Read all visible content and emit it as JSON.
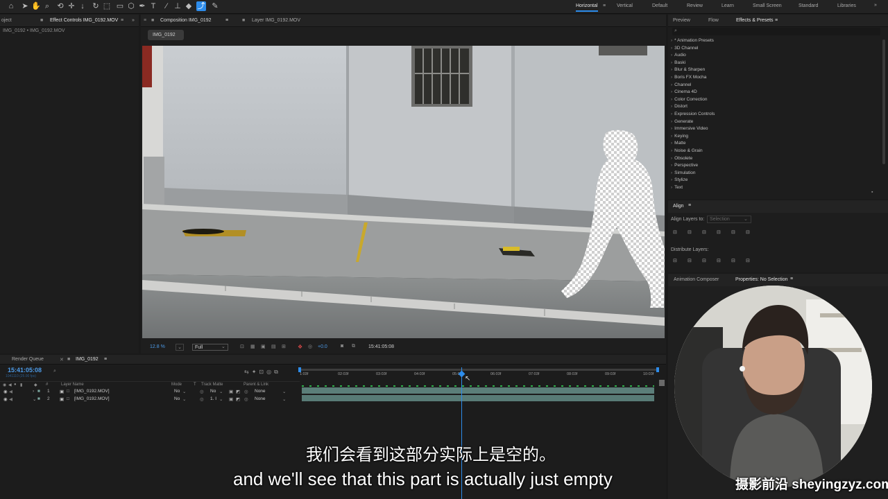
{
  "toolbar": {
    "workspaces": [
      "Horizontal",
      "Vertical",
      "Default",
      "Review",
      "Learn",
      "Small Screen",
      "Standard",
      "Libraries"
    ],
    "active_workspace": "Horizontal"
  },
  "left_panel": {
    "tab_project": "oject",
    "tab_effect_controls": "Effect Controls IMG_0192.MOV",
    "breadcrumb": "IMG_0192 • IMG_0192.MOV"
  },
  "composition": {
    "tab_composition": "Composition IMG_0192",
    "tab_layer": "Layer IMG_0192.MOV",
    "comp_chip": "IMG_0192"
  },
  "viewer_bar": {
    "zoom": "12.8 %",
    "resolution": "Full",
    "exposure": "+0.0",
    "timecode": "15:41:05:08"
  },
  "right_panel": {
    "tabs": [
      "Preview",
      "Flow",
      "Effects & Presets"
    ],
    "effects": [
      "* Animation Presets",
      "3D Channel",
      "Audio",
      "Baski",
      "Blur & Sharpen",
      "Boris FX Mocha",
      "Channel",
      "Cinema 4D",
      "Color Correction",
      "Distort",
      "Expression Controls",
      "Generate",
      "Immersive Video",
      "Keying",
      "Matte",
      "Noise & Grain",
      "Obsolete",
      "Perspective",
      "Simulation",
      "Stylize",
      "Text"
    ],
    "align_title": "Align",
    "align_layers_to": "Align Layers to:",
    "align_target": "Selection",
    "distribute_layers": "Distribute Layers:",
    "tab_animation_composer": "Animation Composer",
    "tab_properties": "Properties: No Selection"
  },
  "timeline": {
    "tab_render_queue": "Render Queue",
    "tab_comp": "IMG_0192",
    "timecode": "15:41:05:08",
    "frames_info": "1041110 (25.00 fps)",
    "headers": {
      "number": "#",
      "layer_name": "Layer Name",
      "mode": "Mode",
      "t": "T",
      "track_matte": "Track Matte",
      "parent": "Parent & Link"
    },
    "ruler": [
      "1:03f",
      "02:03f",
      "03:03f",
      "04:03f",
      "05:03f",
      "06:03f",
      "07:03f",
      "08:03f",
      "09:03f",
      "10:03f"
    ],
    "layers": [
      {
        "num": "1",
        "name": "[IMG_0192.MOV]",
        "mode": "No",
        "matte": "No",
        "parent": "None"
      },
      {
        "num": "2",
        "name": "[IMG_0192.MOV]",
        "mode": "No",
        "matte": "1. I",
        "parent": "None"
      }
    ]
  },
  "subtitles": {
    "chinese": "我们会看到这部分实际上是空的。",
    "english": "and we'll see that this part is actually just empty"
  },
  "watermark": "摄影前沿 sheyingzyz.com"
}
